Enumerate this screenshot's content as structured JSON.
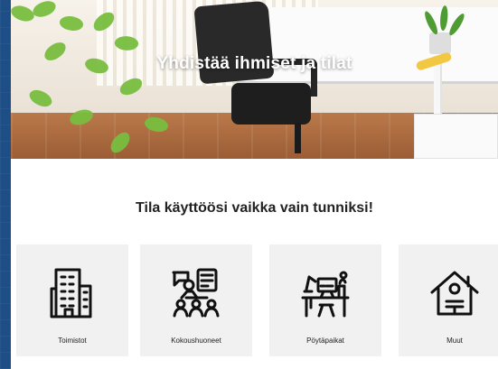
{
  "hero": {
    "title": "Yhdistää ihmiset ja tilat"
  },
  "section": {
    "title": "Tila käyttöösi vaikka vain tunniksi!"
  },
  "cards": [
    {
      "label": "Toimistot",
      "icon": "office-building-icon"
    },
    {
      "label": "Kokoushuoneet",
      "icon": "meeting-room-icon"
    },
    {
      "label": "Pöytäpaikat",
      "icon": "desk-workspace-icon"
    },
    {
      "label": "Muut",
      "icon": "house-icon"
    }
  ],
  "colors": {
    "background": "#1d4f86",
    "panel": "#ffffff",
    "card": "#f1f1f1",
    "text": "#222222",
    "icon": "#111111"
  }
}
